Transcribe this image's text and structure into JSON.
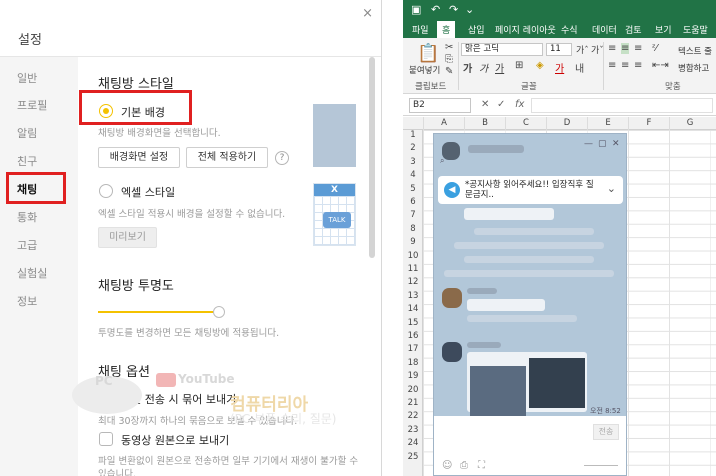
{
  "settings": {
    "title": "설정",
    "close_glyph": "×",
    "nav": [
      "일반",
      "프로필",
      "알림",
      "친구",
      "채팅",
      "통화",
      "고급",
      "실험실",
      "정보"
    ],
    "active_nav": "채팅",
    "section_style": "채팅방 스타일",
    "radio_basic_label": "기본 배경",
    "radio_basic_desc": "채팅방 배경화면을 선택합니다.",
    "btn_bg_settings": "배경화면 설정",
    "btn_apply_all": "전체 적용하기",
    "help_glyph": "?",
    "radio_excel_label": "엑셀 스타일",
    "radio_excel_desc": "엑셀 스타일 적용시 배경을 설정할 수 없습니다.",
    "btn_preview": "미리보기",
    "thumb_excel_x": "X",
    "thumb_excel_talk": "TALK",
    "section_opacity": "채팅방 투명도",
    "opacity_value": 0.9,
    "opacity_desc": "투명도를 변경하면 모든 채팅방에 적용됩니다.",
    "section_options": "채팅 옵션",
    "opt_photo_label": "사진 전송 시 묶어 보내기",
    "opt_photo_desc": "최대 30장까지 하나의 묶음으로 보낼 수 있습니다.",
    "opt_video_label": "동영상 원본으로 보내기",
    "opt_video_desc": "파일 변환없이 원본으로 전송하면 일부 기기에서 재생이 불가할 수 있습니다.",
    "watermark_youtube": "YouTube",
    "watermark_pc": "PC",
    "watermark_title": "컴퓨터리아",
    "watermark_sub": "(PC 부품 수리, 질문)"
  },
  "excel": {
    "tabs": [
      "파일",
      "홈",
      "삽입",
      "페이지 레이아웃",
      "수식",
      "데이터",
      "검토",
      "보기",
      "도움말"
    ],
    "active_tab": "홈",
    "paste_label": "붙여넣기",
    "font_name": "맑은 고딕",
    "font_size": "11",
    "wrap_text": "텍스트 줄",
    "merge_label": "병합하고",
    "group_clipboard": "클립보드",
    "group_font": "글꼴",
    "group_align": "맞춤",
    "name_box": "B2",
    "fx": "fx",
    "columns": [
      "A",
      "B",
      "C",
      "D",
      "E",
      "F",
      "G"
    ],
    "rows": [
      "1",
      "2",
      "3",
      "4",
      "5",
      "6",
      "7",
      "8",
      "9",
      "10",
      "11",
      "12",
      "13",
      "14",
      "15",
      "16",
      "17",
      "18",
      "19",
      "20",
      "21",
      "22",
      "23",
      "24",
      "25"
    ],
    "accent": "#217346"
  },
  "chat": {
    "notice_icon": "◀",
    "notice_text": "*공지사항 읽어주세요!! 입장직후 질문금지..",
    "notice_chevron": "⌄",
    "send_label": "전송",
    "time_label": "오전 8:52",
    "background": "#b2c7d9"
  }
}
